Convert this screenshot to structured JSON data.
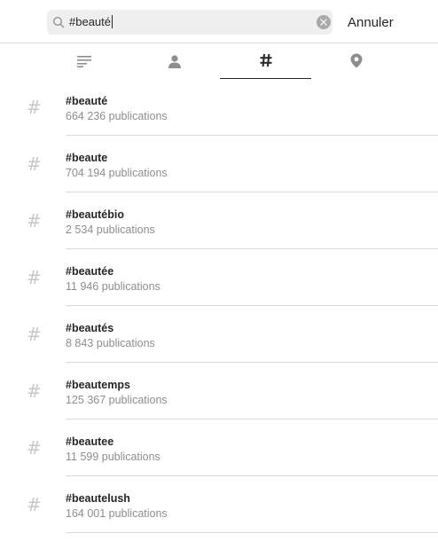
{
  "search": {
    "value": "#beauté"
  },
  "cancel_label": "Annuler",
  "tabs": [
    {
      "icon": "top-results-icon",
      "active": false
    },
    {
      "icon": "accounts-icon",
      "active": false
    },
    {
      "icon": "hashtag-icon",
      "active": true
    },
    {
      "icon": "location-pin-icon",
      "active": false
    }
  ],
  "results": [
    {
      "tag": "#beauté",
      "count": "664 236 publications"
    },
    {
      "tag": "#beaute",
      "count": "704 194 publications"
    },
    {
      "tag": "#beautébio",
      "count": "2 534 publications"
    },
    {
      "tag": "#beautée",
      "count": "11 946 publications"
    },
    {
      "tag": "#beautés",
      "count": "8 843 publications"
    },
    {
      "tag": "#beautemps",
      "count": "125 367 publications"
    },
    {
      "tag": "#beautee",
      "count": "11 599 publications"
    },
    {
      "tag": "#beautelush",
      "count": "164 001 publications"
    }
  ],
  "result_icon_glyph": "#",
  "colors": {
    "text": "#262626",
    "secondary": "#8e8e8e",
    "divider": "#dbdbdb",
    "search_bg": "#efefef",
    "icon_inactive": "#8e8e8e"
  }
}
